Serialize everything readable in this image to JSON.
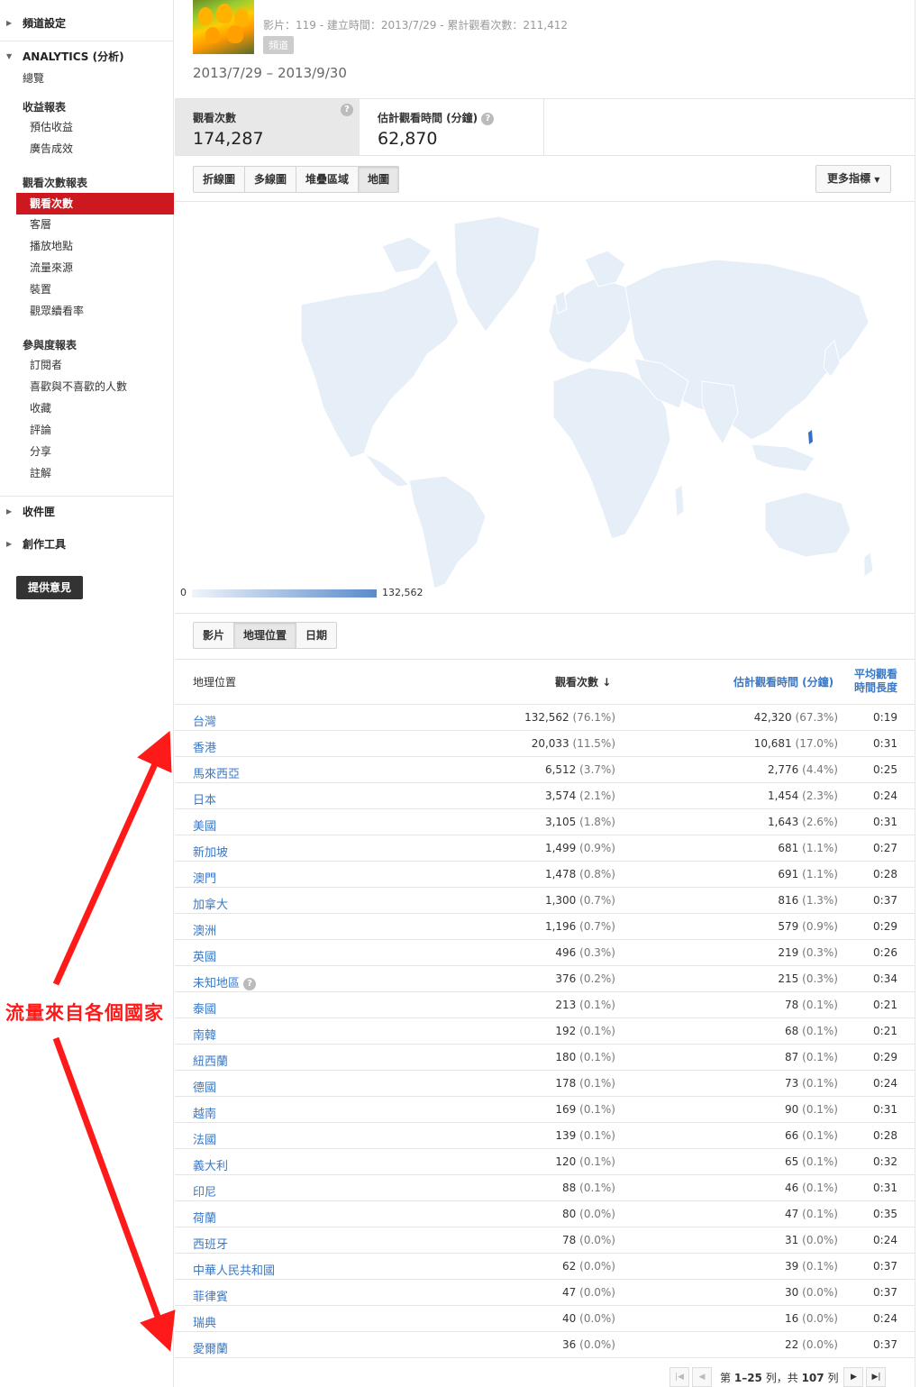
{
  "sidebar": {
    "channel_settings": "頻道設定",
    "analytics": "ANALYTICS (分析)",
    "overview": "總覽",
    "revenue_reports": "收益報表",
    "estimated_revenue": "預估收益",
    "ad_performance": "廣告成效",
    "views_reports": "觀看次數報表",
    "views": "觀看次數",
    "demographics": "客層",
    "playback_locations": "播放地點",
    "traffic_sources": "流量來源",
    "devices": "裝置",
    "audience_retention": "觀眾續看率",
    "engagement_reports": "參與度報表",
    "subscribers": "訂閱者",
    "likes_dislikes": "喜歡與不喜歡的人數",
    "favorites": "收藏",
    "comments": "評論",
    "sharing": "分享",
    "annotations": "註解",
    "inbox": "收件匣",
    "creation_tools": "創作工具",
    "feedback": "提供意見"
  },
  "header": {
    "meta": "影片：119 - 建立時間：2013/7/29 - 累計觀看次數：211,412",
    "badge": "頻道",
    "date_range": "2013/7/29 – 2013/9/30"
  },
  "metrics": {
    "views_label": "觀看次數",
    "views_value": "174,287",
    "watch_time_label": "估計觀看時間 (分鐘)",
    "watch_time_value": "62,870"
  },
  "chart_tabs": [
    "折線圖",
    "多線圖",
    "堆疊區域",
    "地圖"
  ],
  "more_metrics": "更多指標",
  "map_legend": {
    "min": "0",
    "max": "132,562"
  },
  "dimension_tabs": [
    "影片",
    "地理位置",
    "日期"
  ],
  "table": {
    "col_geo": "地理位置",
    "col_views": "觀看次數",
    "col_watch": "估計觀看時間 (分鐘)",
    "col_avg_1": "平均觀看",
    "col_avg_2": "時間長度",
    "rows": [
      {
        "name": "台灣",
        "views": "132,562",
        "vpct": "(76.1%)",
        "watch": "42,320",
        "wpct": "(67.3%)",
        "avg": "0:19"
      },
      {
        "name": "香港",
        "views": "20,033",
        "vpct": "(11.5%)",
        "watch": "10,681",
        "wpct": "(17.0%)",
        "avg": "0:31"
      },
      {
        "name": "馬來西亞",
        "views": "6,512",
        "vpct": "(3.7%)",
        "watch": "2,776",
        "wpct": "(4.4%)",
        "avg": "0:25"
      },
      {
        "name": "日本",
        "views": "3,574",
        "vpct": "(2.1%)",
        "watch": "1,454",
        "wpct": "(2.3%)",
        "avg": "0:24"
      },
      {
        "name": "美國",
        "views": "3,105",
        "vpct": "(1.8%)",
        "watch": "1,643",
        "wpct": "(2.6%)",
        "avg": "0:31"
      },
      {
        "name": "新加坡",
        "views": "1,499",
        "vpct": "(0.9%)",
        "watch": "681",
        "wpct": "(1.1%)",
        "avg": "0:27"
      },
      {
        "name": "澳門",
        "views": "1,478",
        "vpct": "(0.8%)",
        "watch": "691",
        "wpct": "(1.1%)",
        "avg": "0:28"
      },
      {
        "name": "加拿大",
        "views": "1,300",
        "vpct": "(0.7%)",
        "watch": "816",
        "wpct": "(1.3%)",
        "avg": "0:37"
      },
      {
        "name": "澳洲",
        "views": "1,196",
        "vpct": "(0.7%)",
        "watch": "579",
        "wpct": "(0.9%)",
        "avg": "0:29"
      },
      {
        "name": "英國",
        "views": "496",
        "vpct": "(0.3%)",
        "watch": "219",
        "wpct": "(0.3%)",
        "avg": "0:26"
      },
      {
        "name": "未知地區",
        "views": "376",
        "vpct": "(0.2%)",
        "watch": "215",
        "wpct": "(0.3%)",
        "avg": "0:34"
      },
      {
        "name": "泰國",
        "views": "213",
        "vpct": "(0.1%)",
        "watch": "78",
        "wpct": "(0.1%)",
        "avg": "0:21"
      },
      {
        "name": "南韓",
        "views": "192",
        "vpct": "(0.1%)",
        "watch": "68",
        "wpct": "(0.1%)",
        "avg": "0:21"
      },
      {
        "name": "紐西蘭",
        "views": "180",
        "vpct": "(0.1%)",
        "watch": "87",
        "wpct": "(0.1%)",
        "avg": "0:29"
      },
      {
        "name": "德國",
        "views": "178",
        "vpct": "(0.1%)",
        "watch": "73",
        "wpct": "(0.1%)",
        "avg": "0:24"
      },
      {
        "name": "越南",
        "views": "169",
        "vpct": "(0.1%)",
        "watch": "90",
        "wpct": "(0.1%)",
        "avg": "0:31"
      },
      {
        "name": "法國",
        "views": "139",
        "vpct": "(0.1%)",
        "watch": "66",
        "wpct": "(0.1%)",
        "avg": "0:28"
      },
      {
        "name": "義大利",
        "views": "120",
        "vpct": "(0.1%)",
        "watch": "65",
        "wpct": "(0.1%)",
        "avg": "0:32"
      },
      {
        "name": "印尼",
        "views": "88",
        "vpct": "(0.1%)",
        "watch": "46",
        "wpct": "(0.1%)",
        "avg": "0:31"
      },
      {
        "name": "荷蘭",
        "views": "80",
        "vpct": "(0.0%)",
        "watch": "47",
        "wpct": "(0.1%)",
        "avg": "0:35"
      },
      {
        "name": "西班牙",
        "views": "78",
        "vpct": "(0.0%)",
        "watch": "31",
        "wpct": "(0.0%)",
        "avg": "0:24"
      },
      {
        "name": "中華人民共和國",
        "views": "62",
        "vpct": "(0.0%)",
        "watch": "39",
        "wpct": "(0.1%)",
        "avg": "0:37"
      },
      {
        "name": "菲律賓",
        "views": "47",
        "vpct": "(0.0%)",
        "watch": "30",
        "wpct": "(0.0%)",
        "avg": "0:37"
      },
      {
        "name": "瑞典",
        "views": "40",
        "vpct": "(0.0%)",
        "watch": "16",
        "wpct": "(0.0%)",
        "avg": "0:24"
      },
      {
        "name": "愛爾蘭",
        "views": "36",
        "vpct": "(0.0%)",
        "watch": "22",
        "wpct": "(0.0%)",
        "avg": "0:37"
      }
    ]
  },
  "pager": {
    "prefix": "第",
    "range": "1–25",
    "mid": "列，共",
    "total": "107",
    "suffix": "列"
  },
  "annotation": "流量來自各個國家",
  "colors": {
    "accent_red": "#cc181e",
    "link_blue": "#3a78c6",
    "map_land": "#e6eef8",
    "map_max": "#5a8bcb",
    "annotation_red": "#ff1a1a"
  }
}
